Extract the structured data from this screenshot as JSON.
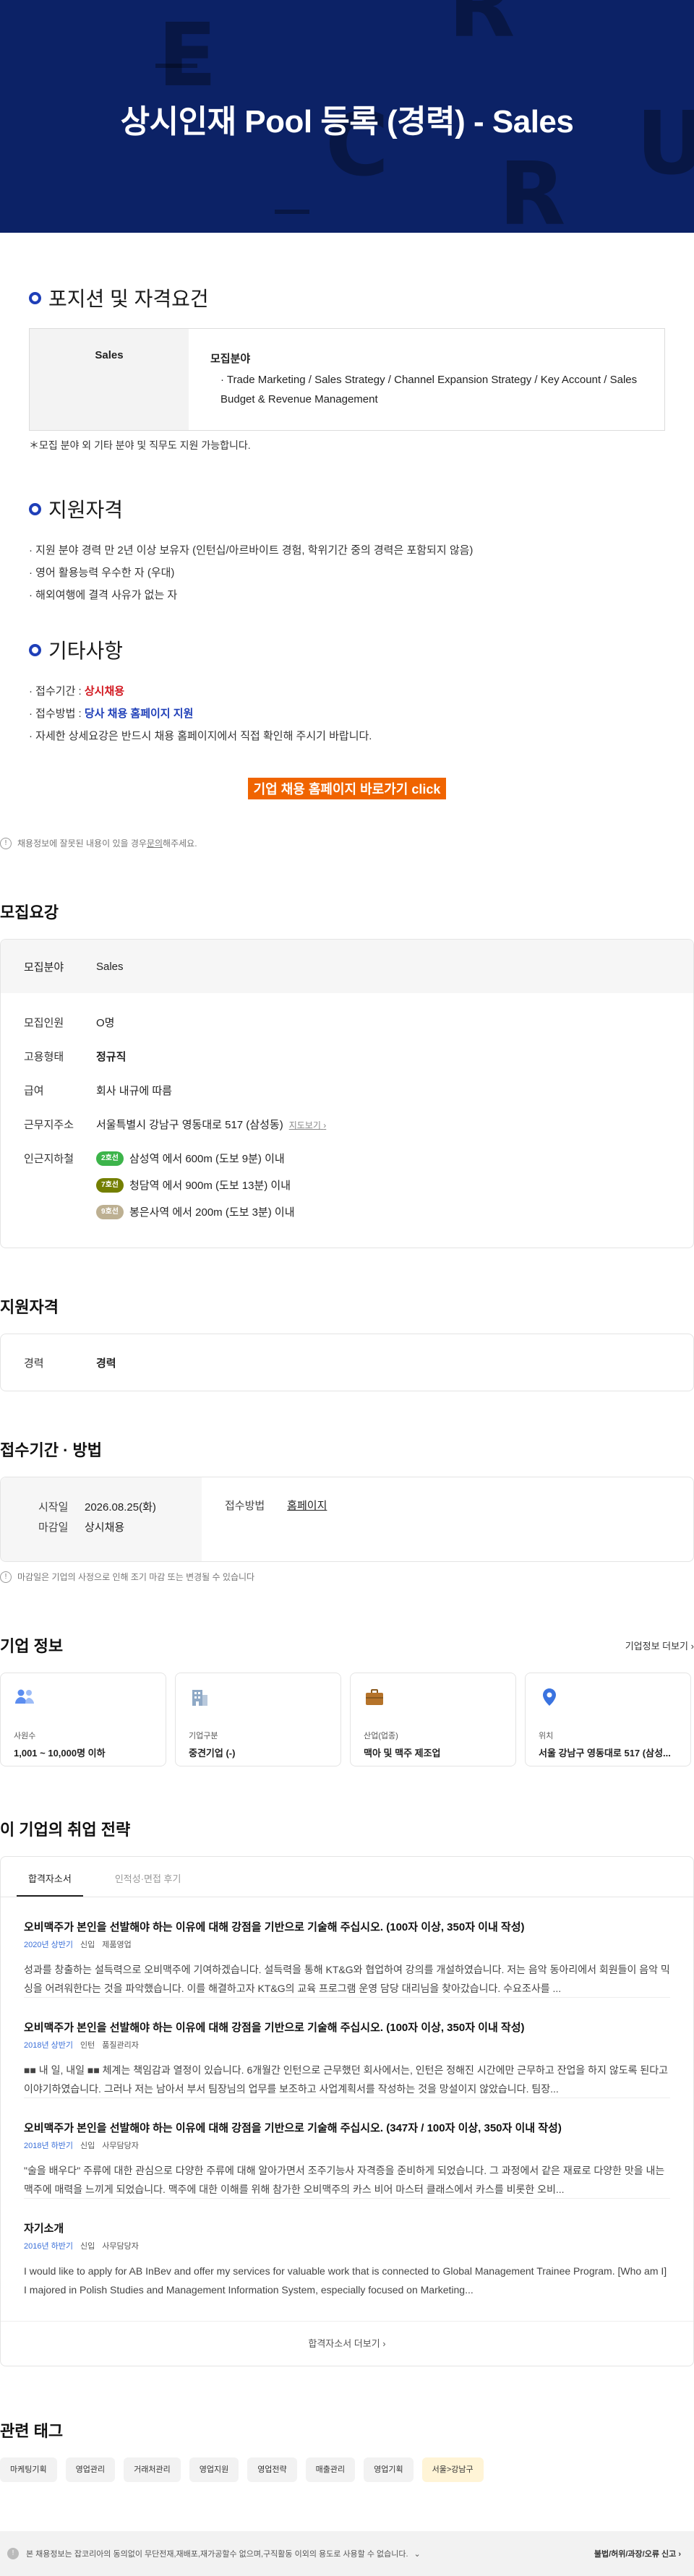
{
  "hero": {
    "title": "상시인재 Pool 등록 (경력) - Sales",
    "ghost_letters": [
      "E",
      "C",
      "R",
      "U",
      "T",
      "R"
    ],
    "bg_color": "#0c2266"
  },
  "position": {
    "heading": "포지션 및 자격요건",
    "field_name": "Sales",
    "field_label": "모집분야",
    "field_value": "Trade Marketing / Sales Strategy / Channel Expansion Strategy / Key Account / Sales Budget & Revenue Management",
    "note": "＊모집 분야 외 기타 분야 및 직무도 지원 가능합니다."
  },
  "qualification": {
    "heading": "지원자격",
    "items": [
      "· 지원 분야 경력 만 2년 이상 보유자 (인턴십/아르바이트 경험, 학위기간 중의 경력은 포함되지 않음)",
      "· 영어 활용능력 우수한 자 (우대)",
      "· 해외여행에 결격 사유가 없는 자"
    ]
  },
  "etc": {
    "heading": "기타사항",
    "period_label": "· 접수기간 : ",
    "period_value": "상시채용",
    "method_label": "· 접수방법 : ",
    "method_value": "당사 채용 홈페이지 지원",
    "detail": "· 자세한 상세요강은 반드시 채용 홈페이지에서 직접 확인해 주시기 바랍니다.",
    "cta": "기업 채용 홈페이지 바로가기 click"
  },
  "report": {
    "icon": "!",
    "text_before": "채용정보에 잘못된 내용이 있을 경우 ",
    "link": "문의",
    "text_after": "해주세요."
  },
  "recruit": {
    "heading": "모집요강",
    "field_label": "모집분야",
    "field_value": "Sales",
    "headcount_label": "모집인원",
    "headcount_value": "O명",
    "type_label": "고용형태",
    "type_value": "정규직",
    "salary_label": "급여",
    "salary_value": "회사 내규에 따름",
    "address_label": "근무지주소",
    "address_value": "서울특별시 강남구 영동대로 517 (삼성동)",
    "map_link": "지도보기",
    "subway_label": "인근지하철",
    "subways": [
      {
        "line": "2호선",
        "text": "삼성역 에서 600m (도보 9분) 이내",
        "color": "#3cb44a"
      },
      {
        "line": "7호선",
        "text": "청담역 에서 900m (도보 13분) 이내",
        "color": "#747f00"
      },
      {
        "line": "9호선",
        "text": "봉은사역 에서 200m (도보 3분) 이내",
        "color": "#bdb092"
      }
    ]
  },
  "apply_qual": {
    "heading": "지원자격",
    "career_label": "경력",
    "career_value": "경력"
  },
  "period": {
    "heading": "접수기간 · 방법",
    "start_label": "시작일",
    "start_value": "2026.08.25(화)",
    "end_label": "마감일",
    "end_value": "상시채용",
    "method_label": "접수방법",
    "method_value": "홈페이지",
    "note": "마감일은 기업의 사정으로 인해 조기 마감 또는 변경될 수 있습니다"
  },
  "company": {
    "heading": "기업 정보",
    "more": "기업정보 더보기",
    "cards": [
      {
        "icon": "people-icon",
        "label": "사원수",
        "value": "1,001 ~ 10,000명 이하"
      },
      {
        "icon": "building-icon",
        "label": "기업구분",
        "value": "중견기업 (-)"
      },
      {
        "icon": "briefcase-icon",
        "label": "산업(업종)",
        "value": "맥아 및 맥주 제조업"
      },
      {
        "icon": "location-pin-icon",
        "label": "위치",
        "value": "서울 강남구 영동대로 517 (삼성..."
      }
    ]
  },
  "strategy": {
    "heading": "이 기업의 취업 전략",
    "tabs": [
      "합격자소서",
      "인적성·면접 후기"
    ],
    "essays": [
      {
        "q": "오비맥주가 본인을 선발해야 하는 이유에 대해 강점을 기반으로 기술해 주십시오. (100자 이상, 350자 이내 작성)",
        "year": "2020년 상반기",
        "tag1": "신입",
        "tag2": "제품영업",
        "body": "성과를 창출하는 설득력으로 오비맥주에 기여하겠습니다. 설득력을 통해 KT&G와 협업하여 강의를 개설하였습니다. 저는 음악 동아리에서 회원들이 음악 믹싱을 어려워한다는 것을 파악했습니다. 이를 해결하고자 KT&G의 교육 프로그램 운영 담당 대리님을 찾아갔습니다. 수요조사를 ..."
      },
      {
        "q": "오비맥주가 본인을 선발해야 하는 이유에 대해 강점을 기반으로 기술해 주십시오. (100자 이상, 350자 이내 작성)",
        "year": "2018년 상반기",
        "tag1": "인턴",
        "tag2": "품질관리자",
        "body": "■■ 내 일, 내일 ■■ 체계는 책임감과 열정이 있습니다. 6개월간 인턴으로 근무했던 회사에서는, 인턴은 정해진 시간에만 근무하고 잔업을 하지 않도록 된다고 이야기하였습니다. 그러나 저는 남아서 부서 팀장님의 업무를 보조하고 사업계획서를 작성하는 것을 망설이지 않았습니다. 팀장..."
      },
      {
        "q": "오비맥주가 본인을 선발해야 하는 이유에 대해 강점을 기반으로 기술해 주십시오. (347자 / 100자 이상, 350자 이내 작성)",
        "year": "2018년 하반기",
        "tag1": "신입",
        "tag2": "사무담당자",
        "body": "\"술을 배우다\" 주류에 대한 관심으로 다양한 주류에 대해 알아가면서 조주기능사 자격증을 준비하게 되었습니다. 그 과정에서 같은 재료로 다양한 맛을 내는 맥주에 매력을 느끼게 되었습니다. 맥주에 대한 이해를 위해 참가한 오비맥주의 카스 비어 마스터 클래스에서 카스를 비롯한 오비..."
      },
      {
        "q": "자기소개",
        "year": "2016년 하반기",
        "tag1": "신입",
        "tag2": "사무담당자",
        "body": "I would like to apply for AB InBev and offer my services for valuable work that is connected to Global Management Trainee Program. [Who am I] I majored in Polish Studies and Management Information System, especially focused on Marketing..."
      }
    ],
    "more": "합격자소서 더보기"
  },
  "tags": {
    "heading": "관련 태그",
    "items": [
      "마케팅기획",
      "영업관리",
      "거래처관리",
      "영업지원",
      "영업전략",
      "매출관리",
      "영업기획",
      "서울>강남구"
    ]
  },
  "footer": {
    "warn": "!",
    "text": "본 채용정보는 잡코리아의 동의없이 무단전재,재배포,재가공할수 없으며,구직활동 이외의 용도로 사용할 수 없습니다.",
    "right": "불법/허위/과장/오류 신고"
  }
}
